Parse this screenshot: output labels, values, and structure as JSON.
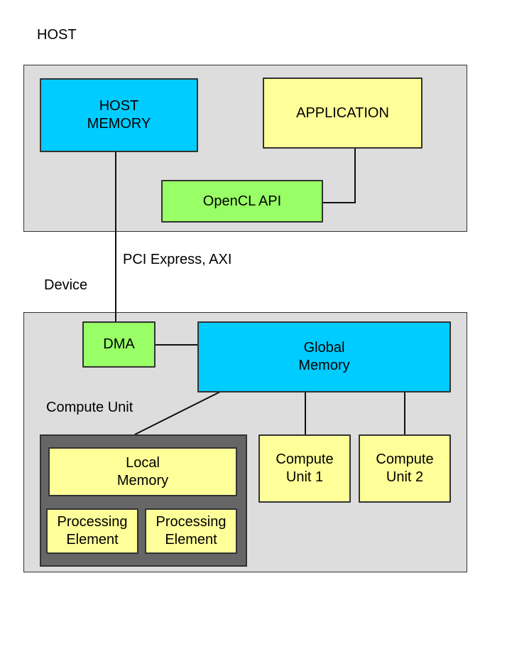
{
  "labels": {
    "host": "HOST",
    "device": "Device",
    "bus": "PCI Express, AXI",
    "compute_unit": "Compute Unit"
  },
  "host": {
    "host_memory": [
      "HOST",
      "MEMORY"
    ],
    "application": "APPLICATION",
    "opencl_api": "OpenCL API"
  },
  "device": {
    "dma": "DMA",
    "global_memory": [
      "Global",
      "Memory"
    ],
    "compute_unit_1": [
      "Compute",
      "Unit 1"
    ],
    "compute_unit_2": [
      "Compute",
      "Unit 2"
    ],
    "local_memory": [
      "Local",
      "Memory"
    ],
    "processing_elements": [
      [
        "Processing",
        "Element"
      ],
      [
        "Processing",
        "Element"
      ]
    ]
  },
  "colors": {
    "region": "#dddddd",
    "memory": "#00ccff",
    "compute": "#ffff99",
    "interface": "#99ff66",
    "compute_unit_container": "#666666"
  }
}
